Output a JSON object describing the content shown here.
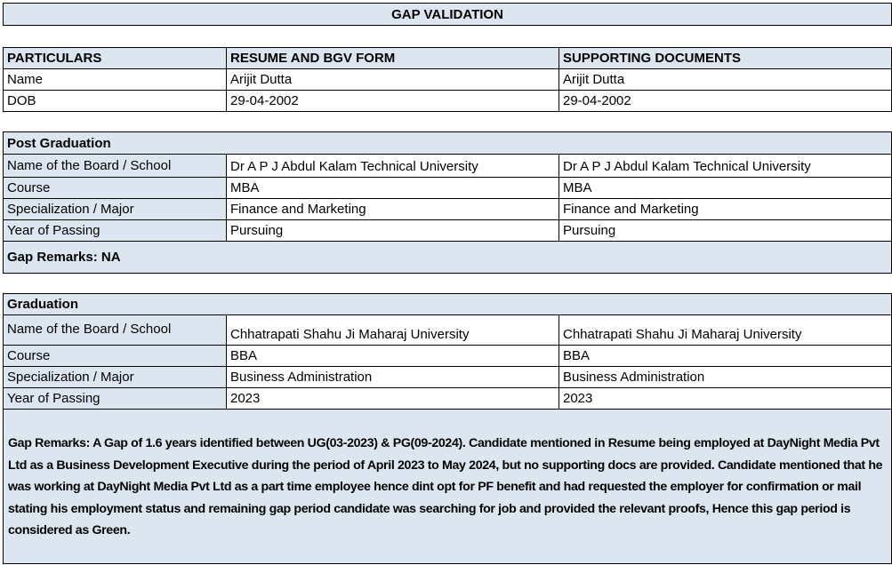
{
  "title": "GAP VALIDATION",
  "summary": {
    "headers": [
      "PARTICULARS",
      "RESUME AND BGV FORM",
      "SUPPORTING DOCUMENTS"
    ],
    "rows": [
      {
        "label": "Name",
        "resume": "Arijit Dutta",
        "docs": "Arijit Dutta"
      },
      {
        "label": "DOB",
        "resume": "29-04-2002",
        "docs": "29-04-2002"
      }
    ]
  },
  "post_graduation": {
    "heading": "Post Graduation",
    "rows": [
      {
        "label": "Name of the Board / School",
        "resume": "Dr A P J Abdul Kalam Technical University",
        "docs": "Dr A P J Abdul Kalam Technical University"
      },
      {
        "label": "Course",
        "resume": "MBA",
        "docs": "MBA"
      },
      {
        "label": "Specialization / Major",
        "resume": "Finance and Marketing",
        "docs": "Finance and Marketing"
      },
      {
        "label": "Year of Passing",
        "resume": "Pursuing",
        "docs": "Pursuing"
      }
    ],
    "remarks": "Gap Remarks: NA"
  },
  "graduation": {
    "heading": "Graduation",
    "rows": [
      {
        "label": "Name of the Board / School",
        "resume": "Chhatrapati Shahu Ji Maharaj University",
        "docs": "Chhatrapati Shahu Ji Maharaj University"
      },
      {
        "label": "Course",
        "resume": "BBA",
        "docs": "BBA"
      },
      {
        "label": "Specialization / Major",
        "resume": "Business Administration",
        "docs": "Business Administration"
      },
      {
        "label": "Year of Passing",
        "resume": "2023",
        "docs": "2023"
      }
    ],
    "remarks": "Gap Remarks: A Gap of 1.6 years identified between UG(03-2023) & PG(09-2024). Candidate mentioned in Resume being employed at DayNight Media Pvt Ltd as a Business Development Executive during the period of April 2023 to May 2024, but no supporting docs are provided. Candidate mentioned that he was working at DayNight Media Pvt Ltd as a part time employee hence dint opt for PF benefit and had requested the employer for confirmation or mail stating his employment status and remaining gap period candidate was searching for job and provided the relevant proofs, Hence this gap period is considered as Green."
  }
}
